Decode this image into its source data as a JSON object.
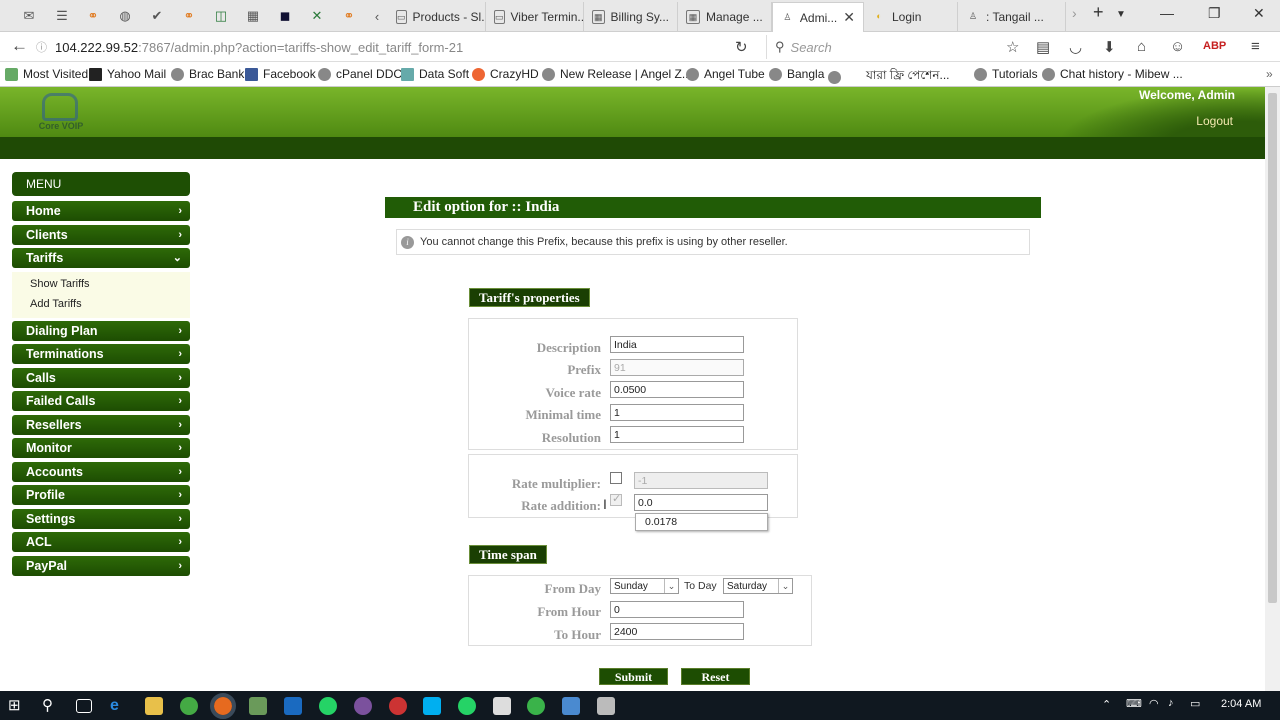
{
  "browser": {
    "tabs": [
      {
        "label": "Products - Sl..."
      },
      {
        "label": "Viber Termin..."
      },
      {
        "label": "Billing Sy..."
      },
      {
        "label": "Manage ..."
      },
      {
        "label": "Admi...",
        "active": true
      },
      {
        "label": "Login"
      },
      {
        "label": ": Tangail ..."
      }
    ],
    "url_host": "104.222.99.52",
    "url_path": ":7867/admin.php?action=tariffs-show_edit_tariff_form-21",
    "search_placeholder": "Search",
    "bookmarks": [
      "Most Visited",
      "Yahoo Mail",
      "Brac Bank",
      "Facebook",
      "cPanel DDC",
      "Data Soft",
      "CrazyHD",
      "New Release | Angel Z...",
      "Angel Tube",
      "Bangla",
      "যারা ফ্রি পেশেন...",
      "Tutorials",
      "Chat history - Mibew ..."
    ]
  },
  "header": {
    "logo_text": "Core VOIP",
    "welcome": "Welcome, Admin",
    "logout": "Logout"
  },
  "menu": {
    "title": "MENU",
    "items": [
      {
        "label": "Home",
        "arrow": "›"
      },
      {
        "label": "Clients",
        "arrow": "›"
      },
      {
        "label": "Tariffs",
        "arrow": "⌄",
        "expanded": true
      },
      {
        "label": "Dialing Plan",
        "arrow": "›"
      },
      {
        "label": "Terminations",
        "arrow": "›"
      },
      {
        "label": "Calls",
        "arrow": "›"
      },
      {
        "label": "Failed Calls",
        "arrow": "›"
      },
      {
        "label": "Resellers",
        "arrow": "›"
      },
      {
        "label": "Monitor",
        "arrow": "›"
      },
      {
        "label": "Accounts",
        "arrow": "›"
      },
      {
        "label": "Profile",
        "arrow": "›"
      },
      {
        "label": "Settings",
        "arrow": "›"
      },
      {
        "label": "ACL",
        "arrow": "›"
      },
      {
        "label": "PayPal",
        "arrow": "›"
      }
    ],
    "tariffs_sub": [
      "Show Tariffs",
      "Add Tariffs"
    ]
  },
  "content": {
    "title": "Edit option for :: India",
    "notice": "You cannot change this Prefix, because this prefix is using by other reseller.",
    "tariff_properties": {
      "heading": "Tariff's properties",
      "description_label": "Description",
      "description_value": "India",
      "prefix_label": "Prefix",
      "prefix_value": "91",
      "voice_rate_label": "Voice rate",
      "voice_rate_value": "0.0500",
      "minimal_time_label": "Minimal time",
      "minimal_time_value": "1",
      "resolution_label": "Resolution",
      "resolution_value": "1"
    },
    "rates": {
      "multiplier_label": "Rate multiplier:",
      "multiplier_value": "-1",
      "multiplier_checked": false,
      "addition_label": "Rate addition:",
      "addition_value": "0.0",
      "addition_checked": true,
      "autocomplete": "0.0178"
    },
    "time_span": {
      "heading": "Time span",
      "from_day_label": "From Day",
      "from_day_value": "Sunday",
      "to_day_label": "To Day",
      "to_day_value": "Saturday",
      "from_hour_label": "From Hour",
      "from_hour_value": "0",
      "to_hour_label": "To Hour",
      "to_hour_value": "2400"
    },
    "buttons": {
      "submit": "Submit",
      "reset": "Reset"
    }
  },
  "taskbar": {
    "time": "2:04 AM"
  },
  "colors": {
    "banner_green": "#5a9a18",
    "menu_green": "#1d4d02",
    "label_grey": "#9a9a9a"
  }
}
